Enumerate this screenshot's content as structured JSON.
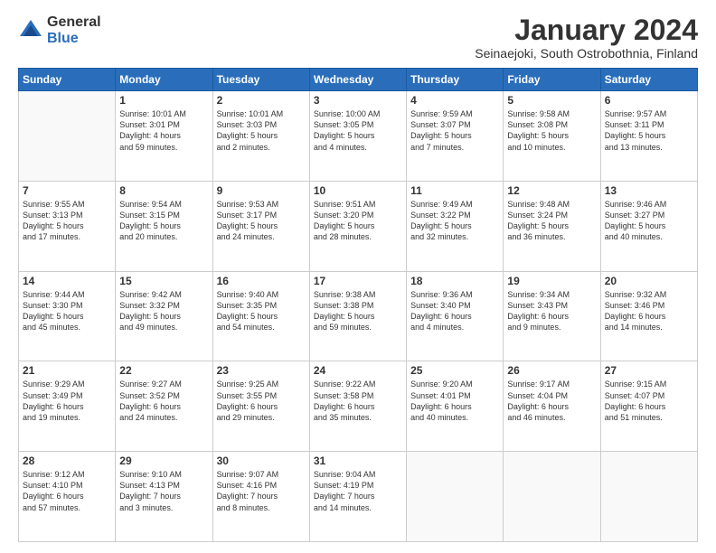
{
  "logo": {
    "general": "General",
    "blue": "Blue"
  },
  "header": {
    "month": "January 2024",
    "location": "Seinaejoki, South Ostrobothnia, Finland"
  },
  "weekdays": [
    "Sunday",
    "Monday",
    "Tuesday",
    "Wednesday",
    "Thursday",
    "Friday",
    "Saturday"
  ],
  "weeks": [
    [
      {
        "day": "",
        "info": ""
      },
      {
        "day": "1",
        "info": "Sunrise: 10:01 AM\nSunset: 3:01 PM\nDaylight: 4 hours\nand 59 minutes."
      },
      {
        "day": "2",
        "info": "Sunrise: 10:01 AM\nSunset: 3:03 PM\nDaylight: 5 hours\nand 2 minutes."
      },
      {
        "day": "3",
        "info": "Sunrise: 10:00 AM\nSunset: 3:05 PM\nDaylight: 5 hours\nand 4 minutes."
      },
      {
        "day": "4",
        "info": "Sunrise: 9:59 AM\nSunset: 3:07 PM\nDaylight: 5 hours\nand 7 minutes."
      },
      {
        "day": "5",
        "info": "Sunrise: 9:58 AM\nSunset: 3:08 PM\nDaylight: 5 hours\nand 10 minutes."
      },
      {
        "day": "6",
        "info": "Sunrise: 9:57 AM\nSunset: 3:11 PM\nDaylight: 5 hours\nand 13 minutes."
      }
    ],
    [
      {
        "day": "7",
        "info": "Sunrise: 9:55 AM\nSunset: 3:13 PM\nDaylight: 5 hours\nand 17 minutes."
      },
      {
        "day": "8",
        "info": "Sunrise: 9:54 AM\nSunset: 3:15 PM\nDaylight: 5 hours\nand 20 minutes."
      },
      {
        "day": "9",
        "info": "Sunrise: 9:53 AM\nSunset: 3:17 PM\nDaylight: 5 hours\nand 24 minutes."
      },
      {
        "day": "10",
        "info": "Sunrise: 9:51 AM\nSunset: 3:20 PM\nDaylight: 5 hours\nand 28 minutes."
      },
      {
        "day": "11",
        "info": "Sunrise: 9:49 AM\nSunset: 3:22 PM\nDaylight: 5 hours\nand 32 minutes."
      },
      {
        "day": "12",
        "info": "Sunrise: 9:48 AM\nSunset: 3:24 PM\nDaylight: 5 hours\nand 36 minutes."
      },
      {
        "day": "13",
        "info": "Sunrise: 9:46 AM\nSunset: 3:27 PM\nDaylight: 5 hours\nand 40 minutes."
      }
    ],
    [
      {
        "day": "14",
        "info": "Sunrise: 9:44 AM\nSunset: 3:30 PM\nDaylight: 5 hours\nand 45 minutes."
      },
      {
        "day": "15",
        "info": "Sunrise: 9:42 AM\nSunset: 3:32 PM\nDaylight: 5 hours\nand 49 minutes."
      },
      {
        "day": "16",
        "info": "Sunrise: 9:40 AM\nSunset: 3:35 PM\nDaylight: 5 hours\nand 54 minutes."
      },
      {
        "day": "17",
        "info": "Sunrise: 9:38 AM\nSunset: 3:38 PM\nDaylight: 5 hours\nand 59 minutes."
      },
      {
        "day": "18",
        "info": "Sunrise: 9:36 AM\nSunset: 3:40 PM\nDaylight: 6 hours\nand 4 minutes."
      },
      {
        "day": "19",
        "info": "Sunrise: 9:34 AM\nSunset: 3:43 PM\nDaylight: 6 hours\nand 9 minutes."
      },
      {
        "day": "20",
        "info": "Sunrise: 9:32 AM\nSunset: 3:46 PM\nDaylight: 6 hours\nand 14 minutes."
      }
    ],
    [
      {
        "day": "21",
        "info": "Sunrise: 9:29 AM\nSunset: 3:49 PM\nDaylight: 6 hours\nand 19 minutes."
      },
      {
        "day": "22",
        "info": "Sunrise: 9:27 AM\nSunset: 3:52 PM\nDaylight: 6 hours\nand 24 minutes."
      },
      {
        "day": "23",
        "info": "Sunrise: 9:25 AM\nSunset: 3:55 PM\nDaylight: 6 hours\nand 29 minutes."
      },
      {
        "day": "24",
        "info": "Sunrise: 9:22 AM\nSunset: 3:58 PM\nDaylight: 6 hours\nand 35 minutes."
      },
      {
        "day": "25",
        "info": "Sunrise: 9:20 AM\nSunset: 4:01 PM\nDaylight: 6 hours\nand 40 minutes."
      },
      {
        "day": "26",
        "info": "Sunrise: 9:17 AM\nSunset: 4:04 PM\nDaylight: 6 hours\nand 46 minutes."
      },
      {
        "day": "27",
        "info": "Sunrise: 9:15 AM\nSunset: 4:07 PM\nDaylight: 6 hours\nand 51 minutes."
      }
    ],
    [
      {
        "day": "28",
        "info": "Sunrise: 9:12 AM\nSunset: 4:10 PM\nDaylight: 6 hours\nand 57 minutes."
      },
      {
        "day": "29",
        "info": "Sunrise: 9:10 AM\nSunset: 4:13 PM\nDaylight: 7 hours\nand 3 minutes."
      },
      {
        "day": "30",
        "info": "Sunrise: 9:07 AM\nSunset: 4:16 PM\nDaylight: 7 hours\nand 8 minutes."
      },
      {
        "day": "31",
        "info": "Sunrise: 9:04 AM\nSunset: 4:19 PM\nDaylight: 7 hours\nand 14 minutes."
      },
      {
        "day": "",
        "info": ""
      },
      {
        "day": "",
        "info": ""
      },
      {
        "day": "",
        "info": ""
      }
    ]
  ]
}
